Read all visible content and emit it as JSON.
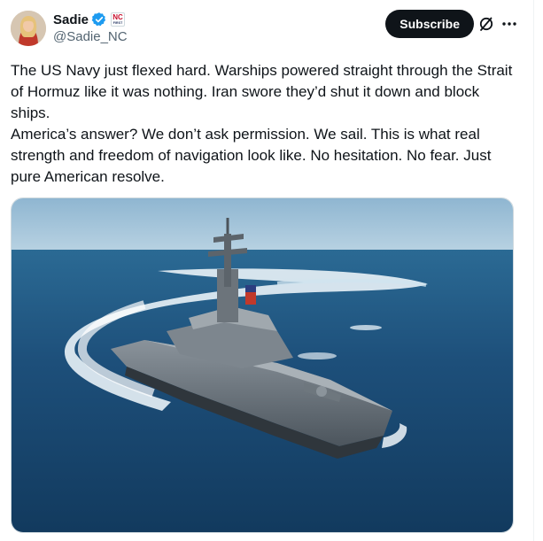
{
  "post": {
    "author": {
      "display_name": "Sadie",
      "handle": "@Sadie_NC",
      "verified": true,
      "affiliate_badge": "NC"
    },
    "actions": {
      "subscribe_label": "Subscribe"
    },
    "text": "The US Navy just flexed hard. Warships powered straight through the Strait of Hormuz like it was nothing. Iran swore they’d shut it down and block ships.\nAmerica’s answer? We don’t ask permission. We sail. This is what real strength and freedom of navigation look like. No hesitation. No fear. Just pure American resolve."
  },
  "icons": {
    "verified": "verified-check-icon",
    "grok": "grok-icon",
    "more": "more-horizontal-icon"
  },
  "colors": {
    "verified_blue": "#1d9bf0",
    "button_bg": "#0f1419",
    "secondary_text": "#536471",
    "sea": "#1d4f7a",
    "sky": "#9cc0d8"
  }
}
